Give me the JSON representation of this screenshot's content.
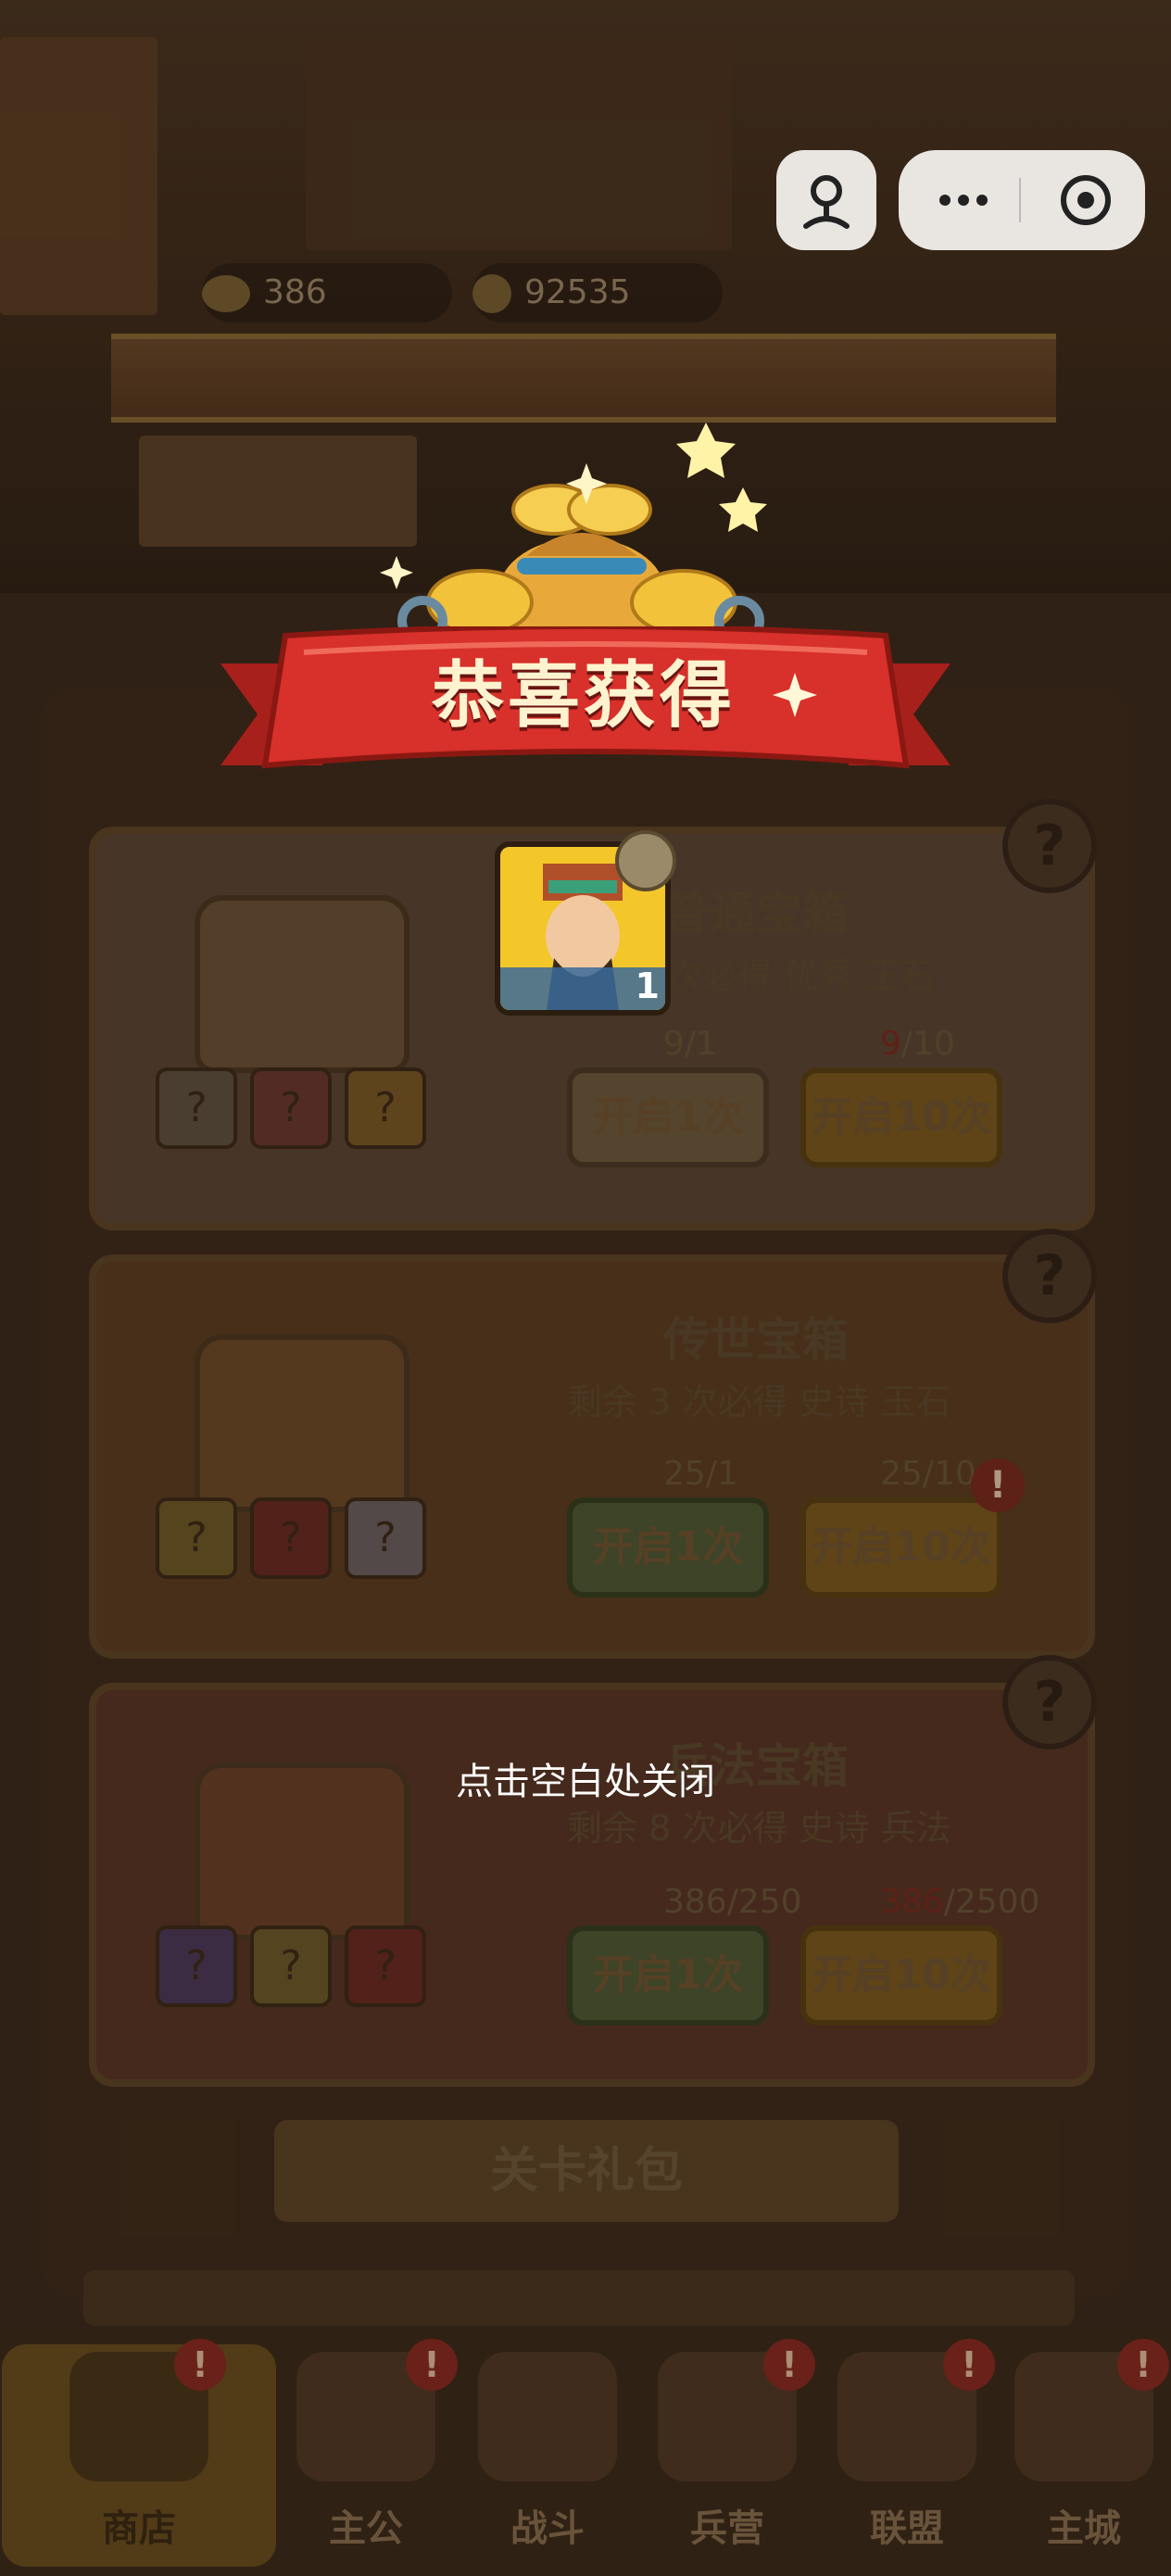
{
  "resources": {
    "jade": "386",
    "coins": "92535"
  },
  "popup": {
    "title": "恭喜获得",
    "reward": {
      "count": "1",
      "icon": "general-portrait"
    },
    "close_hint": "点击空白处关闭"
  },
  "boxes": [
    {
      "title": "普通宝箱",
      "sub": "次必得 优秀 玉石",
      "cost1": "9/1",
      "cost10_owned": "9",
      "cost10_total": "/10",
      "btn1": "开启1次",
      "btn10": "开启10次"
    },
    {
      "title": "传世宝箱",
      "sub": "剩余 3 次必得 史诗 玉石",
      "cost1": "25/1",
      "cost10": "25/10",
      "btn1": "开启1次",
      "btn10": "开启10次"
    },
    {
      "title": "兵法宝箱",
      "sub": "剩余 8 次必得 史诗 兵法",
      "cost1": "386/250",
      "cost10_owned": "386",
      "cost10_total": "/2500",
      "btn1": "开启1次",
      "btn10": "开启10次"
    }
  ],
  "gift_bar": "关卡礼包",
  "tabs": [
    {
      "label": "商店",
      "active": true
    },
    {
      "label": "主公"
    },
    {
      "label": "战斗"
    },
    {
      "label": "兵营"
    },
    {
      "label": "联盟"
    },
    {
      "label": "主城"
    }
  ],
  "colors": {
    "ribbon": "#d8302a",
    "gold": "#f2c23a",
    "button_orange": "#f0a020",
    "button_green": "#3a8a3a"
  }
}
